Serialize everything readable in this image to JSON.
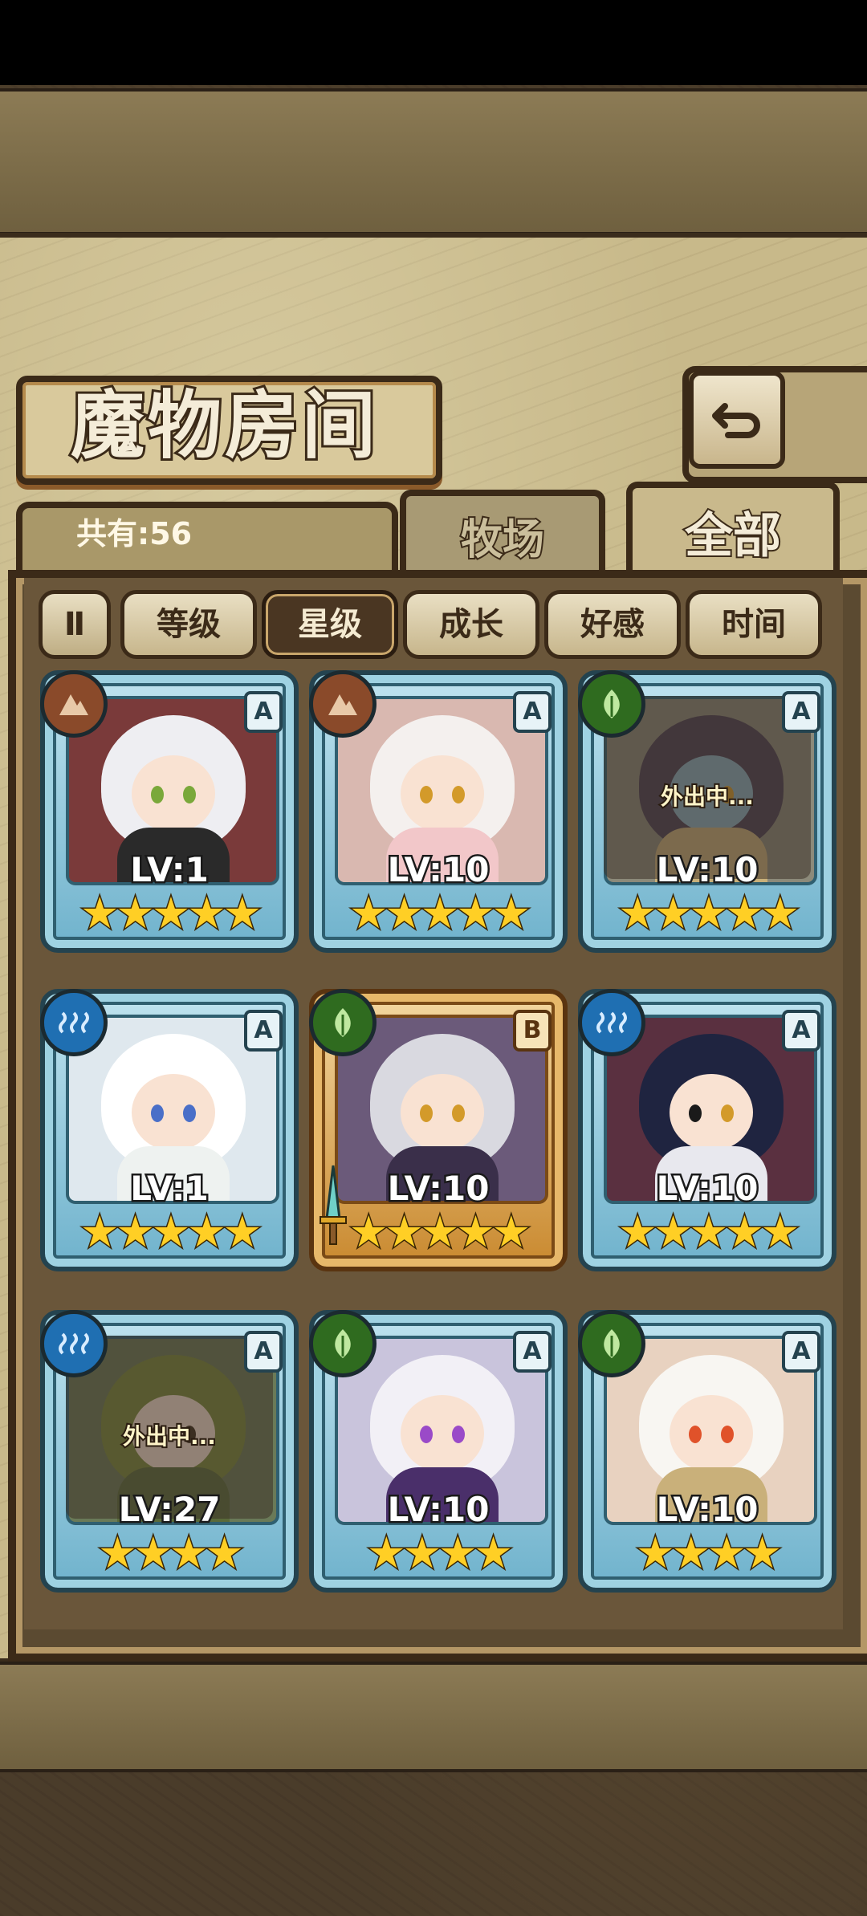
{
  "header": {
    "title": "魔物房间",
    "count_label": "共有:56"
  },
  "tabs": [
    {
      "label": "牧场",
      "active": false
    },
    {
      "label": "全部",
      "active": true
    }
  ],
  "sort_buttons": [
    {
      "label": "等级",
      "active": false
    },
    {
      "label": "星级",
      "active": true
    },
    {
      "label": "成长",
      "active": false
    },
    {
      "label": "好感",
      "active": false
    },
    {
      "label": "时间",
      "active": false
    }
  ],
  "pause_label": "Ⅱ",
  "monsters": [
    {
      "element": "earth",
      "grade": "A",
      "level": "LV:1",
      "stars": "★★★★★",
      "star_count": 5,
      "away": "",
      "frame": "blue"
    },
    {
      "element": "earth",
      "grade": "A",
      "level": "LV:10",
      "stars": "★★★★★",
      "star_count": 5,
      "away": "",
      "frame": "blue"
    },
    {
      "element": "grass",
      "grade": "A",
      "level": "LV:10",
      "stars": "★★★★★",
      "star_count": 5,
      "away": "外出中...",
      "frame": "blue"
    },
    {
      "element": "water",
      "grade": "A",
      "level": "LV:1",
      "stars": "★★★★★",
      "star_count": 5,
      "away": "",
      "frame": "blue"
    },
    {
      "element": "grass",
      "grade": "B",
      "level": "LV:10",
      "stars": "★★★★★",
      "star_count": 5,
      "away": "",
      "frame": "gold"
    },
    {
      "element": "water",
      "grade": "A",
      "level": "LV:10",
      "stars": "★★★★★",
      "star_count": 5,
      "away": "",
      "frame": "blue"
    },
    {
      "element": "water",
      "grade": "A",
      "level": "LV:27",
      "stars": "★★★★",
      "star_count": 4,
      "away": "外出中...",
      "frame": "blue"
    },
    {
      "element": "grass",
      "grade": "A",
      "level": "LV:10",
      "stars": "★★★★",
      "star_count": 4,
      "away": "",
      "frame": "blue"
    },
    {
      "element": "grass",
      "grade": "A",
      "level": "LV:10",
      "stars": "★★★★",
      "star_count": 4,
      "away": "",
      "frame": "blue"
    }
  ],
  "colors": {
    "earth": "#8a4a2a",
    "grass": "#2f6b1f",
    "water": "#1f6fb2"
  }
}
